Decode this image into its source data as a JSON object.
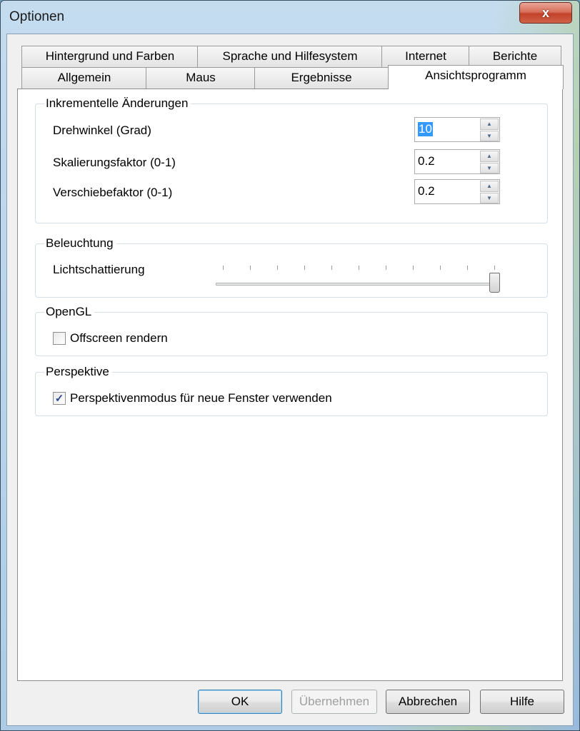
{
  "window": {
    "title": "Optionen",
    "close_glyph": "x"
  },
  "tabs": {
    "row1": [
      "Hintergrund und Farben",
      "Sprache und Hilfesystem",
      "Internet",
      "Berichte"
    ],
    "row2": [
      "Allgemein",
      "Maus",
      "Ergebnisse",
      "Ansichtsprogramm"
    ],
    "active": "Ansichtsprogramm"
  },
  "groups": {
    "incremental": {
      "label": "Inkrementelle Änderungen",
      "rows": [
        {
          "label": "Drehwinkel (Grad)",
          "value": "10"
        },
        {
          "label": "Skalierungsfaktor (0-1)",
          "value": "0.2"
        },
        {
          "label": "Verschiebefaktor (0-1)",
          "value": "0.2"
        }
      ]
    },
    "lighting": {
      "label": "Beleuchtung",
      "slider_label": "Lichtschattierung",
      "slider_level": 1.0
    },
    "opengl": {
      "label": "OpenGL",
      "checkbox_label": "Offscreen rendern",
      "checked": false
    },
    "perspective": {
      "label": "Perspektive",
      "checkbox_label": "Perspektivenmodus für neue Fenster verwenden",
      "checked": true,
      "check_glyph": "✓"
    }
  },
  "buttons": {
    "ok": "OK",
    "apply": "Übernehmen",
    "cancel": "Abbrechen",
    "help": "Hilfe"
  },
  "colors": {
    "close_button": "#c2412a",
    "selection": "#3399ff"
  }
}
